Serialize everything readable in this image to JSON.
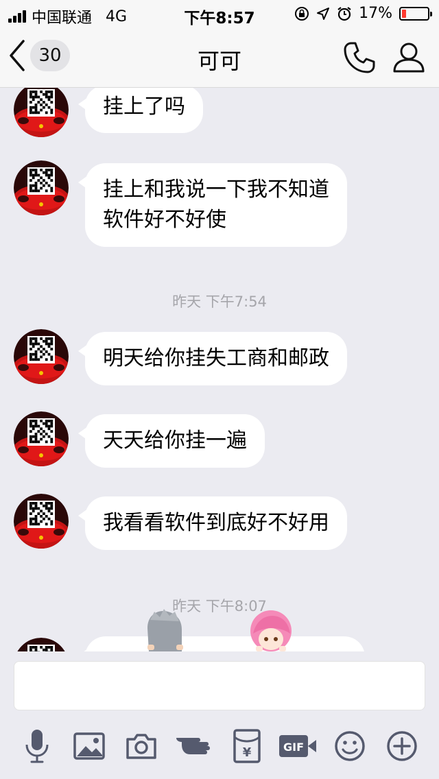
{
  "status_bar": {
    "carrier": "中国联通",
    "network": "4G",
    "time": "下午8:57",
    "battery_percent": "17%",
    "battery_level": 0.17,
    "battery_color": "#ff3b30"
  },
  "nav": {
    "unread_count": "30",
    "title": "可可"
  },
  "messages": [
    {
      "text": "挂上了吗"
    },
    {
      "text": "挂上和我说一下我不知道\n软件好不好使"
    },
    {
      "timestamp": "昨天 下午7:54"
    },
    {
      "text": "明天给你挂失工商和邮政"
    },
    {
      "text": "天天给你挂一遍"
    },
    {
      "text": "我看看软件到底好不好用"
    },
    {
      "timestamp": "昨天 下午8:07"
    }
  ],
  "input": {
    "value": ""
  },
  "toolbar": [
    "mic-icon",
    "image-icon",
    "camera-icon",
    "poke-icon",
    "red-packet-icon",
    "gif-icon",
    "emoji-icon",
    "plus-icon"
  ],
  "colors": {
    "accent": "#555a6e",
    "bubble": "#ffffff",
    "background": "#ebebf1",
    "timestamp": "#a5a5aa"
  }
}
